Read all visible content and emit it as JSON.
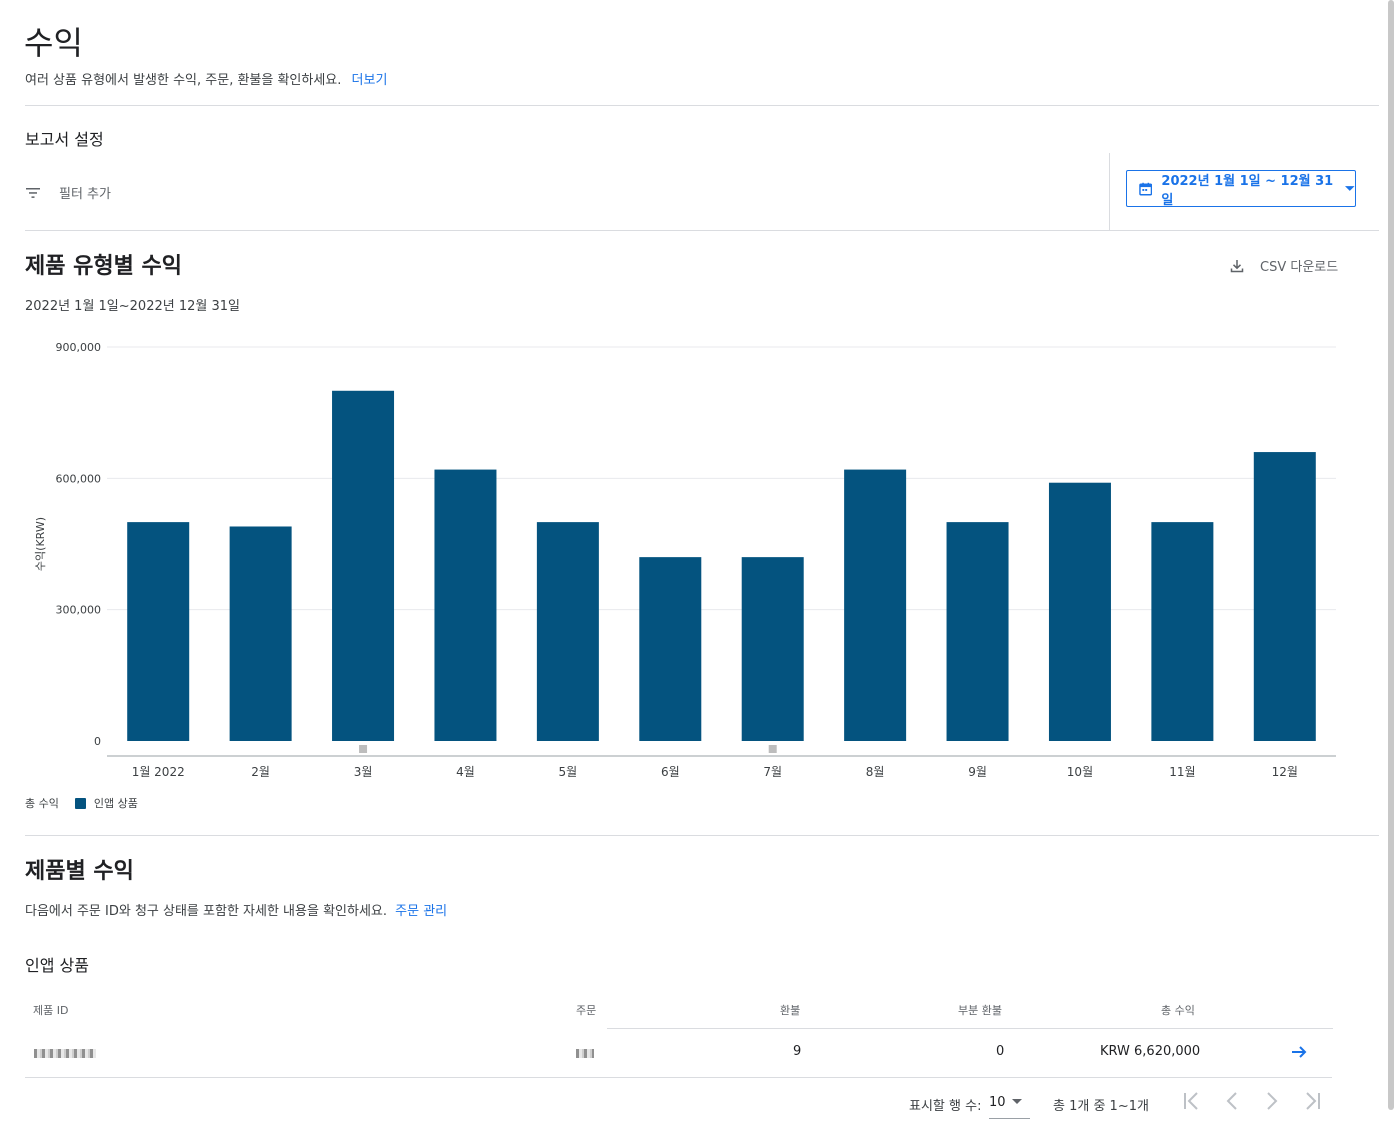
{
  "header": {
    "title": "수익",
    "description": "여러 상품 유형에서 발생한 수익, 주문, 환불을 확인하세요.",
    "more_link": "더보기"
  },
  "report_settings": {
    "label": "보고서 설정",
    "filter_label": "필터 추가",
    "date_range": "2022년 1월 1일 ~ 12월 31일"
  },
  "chart_section": {
    "title": "제품 유형별 수익",
    "subtitle": "2022년 1월 1일~2022년 12월 31일",
    "csv_label": "CSV 다운로드"
  },
  "chart_data": {
    "type": "bar",
    "categories": [
      "1월 2022",
      "2월",
      "3월",
      "4월",
      "5월",
      "6월",
      "7월",
      "8월",
      "9월",
      "10월",
      "11월",
      "12월"
    ],
    "series": [
      {
        "name": "인앱 상품",
        "values": [
          500000,
          490000,
          800000,
          620000,
          500000,
          420000,
          420000,
          620000,
          500000,
          590000,
          500000,
          660000
        ]
      }
    ],
    "ylabel": "수익(KRW)",
    "ylim": [
      0,
      900000
    ],
    "yticks": [
      "0",
      "300,000",
      "600,000",
      "900,000"
    ],
    "ytick_values": [
      0,
      300000,
      600000,
      900000
    ],
    "marker_months": [
      "3월",
      "7월"
    ],
    "grid": true,
    "legend_position": "bottom-left",
    "color": "#04537f"
  },
  "legend": {
    "total_label": "총 수익",
    "series_label": "인앱 상품"
  },
  "product_section": {
    "title": "제품별 수익",
    "description": "다음에서 주문 ID와 청구 상태를 포함한 자세한 내용을 확인하세요.",
    "manage_link": "주문 관리",
    "subsection": "인앱 상품"
  },
  "table": {
    "columns": [
      "제품 ID",
      "주문",
      "환불",
      "부분 환불",
      "총 수익"
    ],
    "rows": [
      {
        "refunds": "9",
        "partial_refunds": "0",
        "total": "KRW 6,620,000"
      }
    ]
  },
  "pagination": {
    "rows_label": "표시할 행 수:",
    "rows_value": "10",
    "range_text": "총 1개 중 1~1개"
  }
}
